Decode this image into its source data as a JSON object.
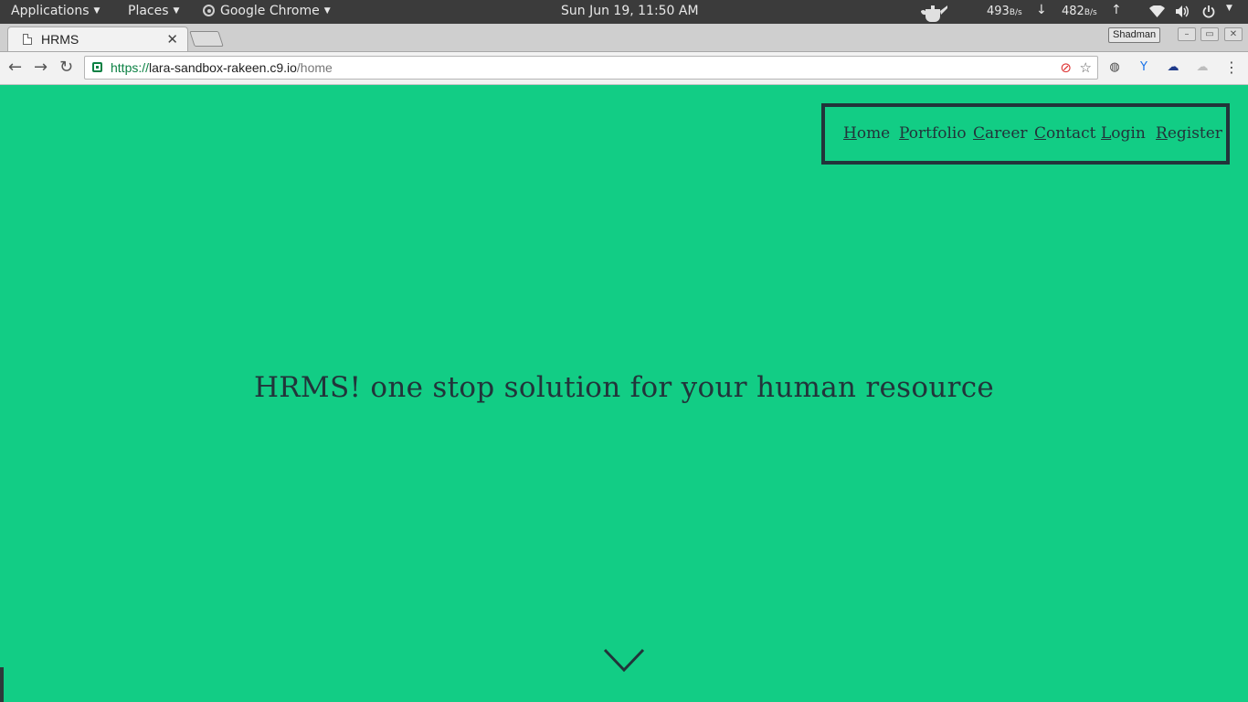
{
  "desktop": {
    "applications_label": "Applications",
    "places_label": "Places",
    "app_name": "Google Chrome",
    "clock": "Sun Jun 19, 11:50 AM",
    "down_rate": "493",
    "down_unit": "B/s",
    "up_rate": "482",
    "up_unit": "B/s",
    "icons": [
      "teapot-icon",
      "download-arrow-icon",
      "upload-arrow-icon",
      "wifi-icon",
      "volume-icon",
      "power-icon",
      "chevron-down-icon"
    ]
  },
  "browser": {
    "tab_title": "HRMS",
    "profile_name": "Shadman",
    "url": {
      "scheme": "https://",
      "host": "lara-sandbox-rakeen.c9.io",
      "path": "/home"
    },
    "icons": [
      "back-icon",
      "forward-icon",
      "reload-icon",
      "lock-icon",
      "blocked-icon",
      "star-icon",
      "extension-icon",
      "menu-icon"
    ]
  },
  "site": {
    "nav": [
      "Home",
      "Portfolio",
      "Career",
      "Contact",
      "Login",
      "Register"
    ],
    "hero_title": "HRMS! one stop solution for your human resource",
    "background_color": "#12cd85",
    "text_color": "#22343a"
  }
}
